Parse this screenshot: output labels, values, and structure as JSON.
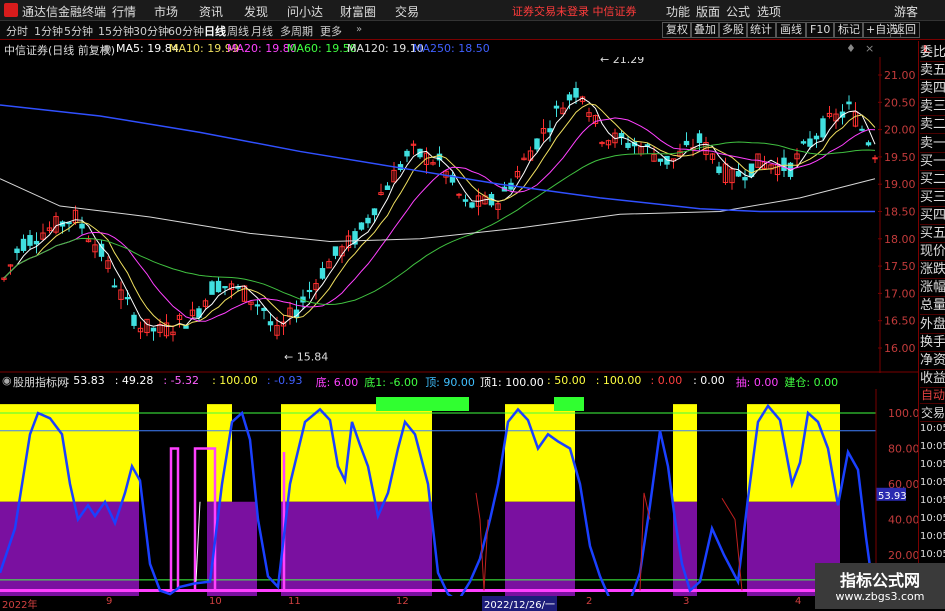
{
  "titlebar": {
    "app_name": "通达信金融终端",
    "menus": [
      "行情",
      "市场",
      "资讯",
      "发现",
      "问小达",
      "财富圈",
      "交易"
    ],
    "warn": "证券交易未登录  中信证券",
    "right": [
      "功能",
      "版面",
      "公式",
      "选项"
    ],
    "guest": "游客"
  },
  "toolbar": {
    "periods": [
      "分时",
      "1分钟",
      "5分钟",
      "15分钟",
      "30分钟",
      "60分钟",
      "日线",
      "周线",
      "月线",
      "多周期",
      "更多"
    ],
    "active": "日线",
    "buttons": [
      "复权",
      "叠加",
      "多股",
      "统计",
      "画线",
      "F10",
      "标记",
      "+自选",
      "返回"
    ]
  },
  "stock": {
    "name": "中信证券(日线 前复权)",
    "ma": [
      {
        "label": "MA5: 19.84",
        "color": "#ffffff"
      },
      {
        "label": "MA10: 19.99",
        "color": "#f0e060"
      },
      {
        "label": "MA20: 19.80",
        "color": "#ff40ff"
      },
      {
        "label": "MA60: 19.58",
        "color": "#40ff40"
      },
      {
        "label": "MA120: 19.10",
        "color": "#e0e0e0"
      },
      {
        "label": "MA250: 18.50",
        "color": "#4060ff"
      }
    ]
  },
  "price_axis": {
    "labels": [
      "21.00",
      "20.50",
      "20.00",
      "19.50",
      "19.00",
      "18.50",
      "18.00",
      "17.50",
      "17.00",
      "16.50",
      "16.00"
    ],
    "high_label": "21.29",
    "low_label": "15.84"
  },
  "indicator": {
    "name": "股朋指标网",
    "values": [
      {
        "t": ": 53.83",
        "c": "#ffffff"
      },
      {
        "t": ": 49.28",
        "c": "#ffffff"
      },
      {
        "t": ": -5.32",
        "c": "#ff60ff"
      },
      {
        "t": ": 100.00",
        "c": "#ffff40"
      },
      {
        "t": ": -0.93",
        "c": "#4060ff"
      },
      {
        "t": "底: 6.00",
        "c": "#ff40ff"
      },
      {
        "t": "底1: -6.00",
        "c": "#40ff40"
      },
      {
        "t": "顶: 90.00",
        "c": "#40c0ff"
      },
      {
        "t": "顶1: 100.00",
        "c": "#ffffff"
      },
      {
        "t": ": 50.00",
        "c": "#ffff40"
      },
      {
        "t": ": 100.00",
        "c": "#ffff40"
      },
      {
        "t": ": 0.00",
        "c": "#ff4040"
      },
      {
        "t": ": 0.00",
        "c": "#ffffff"
      },
      {
        "t": "抽: 0.00",
        "c": "#ff40ff"
      },
      {
        "t": "建仓: 0.00",
        "c": "#40ff40"
      }
    ],
    "axis": [
      "100.00",
      "80.00",
      "60.00",
      "40.00",
      "20.00"
    ],
    "current": "53.93"
  },
  "right_panel": {
    "items": [
      "委比",
      "卖五",
      "卖四",
      "卖三",
      "卖二",
      "卖一",
      "买一",
      "买二",
      "买三",
      "买四",
      "买五",
      "现价",
      "涨跌",
      "涨幅",
      "总量",
      "外盘",
      "换手",
      "净资",
      "收益"
    ],
    "auto": "自动",
    "trade": "交易",
    "times": [
      "10:05",
      "10:05",
      "10:05",
      "10:05",
      "10:05",
      "10:05",
      "10:05",
      "10:05",
      "10:05",
      "10:05"
    ],
    "corner": "L"
  },
  "dates": [
    "2022年",
    "9",
    "10",
    "11",
    "12",
    "2022/12/26/一",
    "2",
    "3",
    "4"
  ],
  "watermark": {
    "line1": "指标公式网",
    "line2": "www.zbgs3.com"
  }
}
